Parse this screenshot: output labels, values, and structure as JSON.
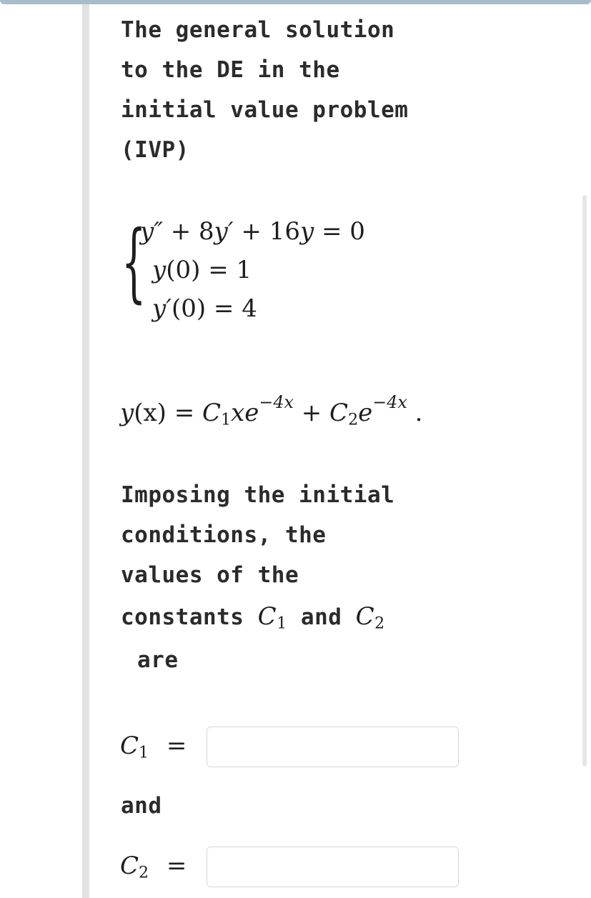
{
  "intro": {
    "line1": "The general solution",
    "line2": "to the DE in the",
    "line3": "initial value problem",
    "line4": "(IVP)"
  },
  "ivp": {
    "equation": {
      "lhs_a": "y″",
      "plus1": " + 8",
      "ya": "y′",
      "plus2": " + 16",
      "yb": "y",
      "rhs": " = 0"
    },
    "condition1": {
      "fn": "y",
      "rest": "(0) = 1"
    },
    "condition2": {
      "fn": "y′",
      "rest": "(0) = 4"
    }
  },
  "general_solution": {
    "y": "y",
    "x1": "(x)",
    "eq": " = ",
    "c1": "C",
    "c1_sub": "1",
    "x2": "xe",
    "exp1": "−4x",
    "plus": " + ",
    "c2": "C",
    "c2_sub": "2",
    "e2": "e",
    "exp2": "−4x",
    "period": " ."
  },
  "imposing": {
    "line1": "Imposing the initial",
    "line2": "conditions, the",
    "line3": "values of the",
    "line4_prefix": "constants",
    "line4_c1": "C",
    "line4_c1_sub": "1",
    "line4_and": "and",
    "line4_c2": "C",
    "line4_c2_sub": "2",
    "line5": "are"
  },
  "answers": {
    "c1_label": "C",
    "c1_sub": "1",
    "c1_eq": "=",
    "c1_value": "",
    "and": "and",
    "c2_label": "C",
    "c2_sub": "2",
    "c2_eq": "=",
    "c2_value": ""
  }
}
